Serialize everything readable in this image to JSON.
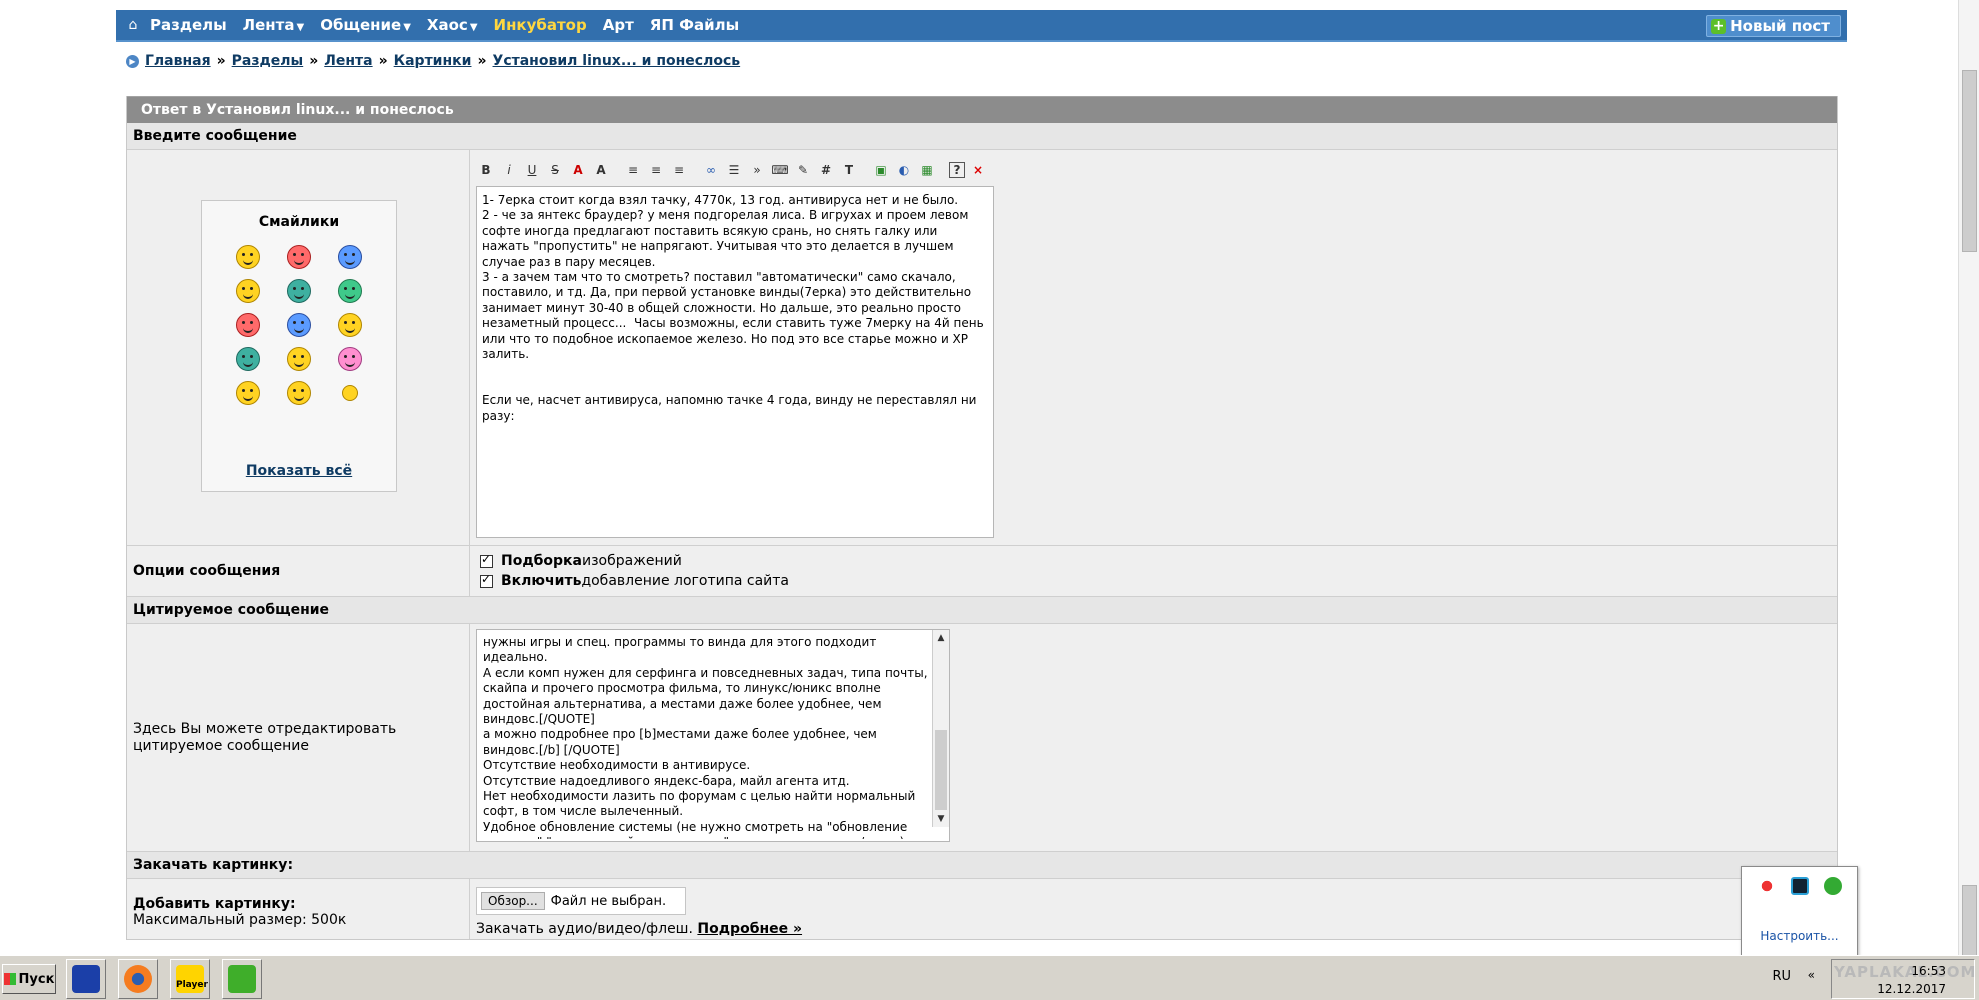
{
  "nav": {
    "items": [
      {
        "label": "Разделы",
        "caret": false,
        "highlight": false
      },
      {
        "label": "Лента",
        "caret": true,
        "highlight": false
      },
      {
        "label": "Общение",
        "caret": true,
        "highlight": false
      },
      {
        "label": "Хаос",
        "caret": true,
        "highlight": false
      },
      {
        "label": "Инкубатор",
        "caret": false,
        "highlight": true
      },
      {
        "label": "Арт",
        "caret": false,
        "highlight": false
      },
      {
        "label": "ЯП Файлы",
        "caret": false,
        "highlight": false
      }
    ],
    "new_post": "Новый пост",
    "home_icon": "home-icon",
    "highlight_color": "#ffd740",
    "bar_color": "#326fad"
  },
  "breadcrumb": [
    "Главная",
    "Разделы",
    "Лента",
    "Картинки",
    "Установил linux... и понеслось"
  ],
  "form": {
    "title": "Ответ в Установил linux... и понеслось",
    "enter_message": "Введите сообщение",
    "smilies_title": "Смайлики",
    "show_all": "Показать всё",
    "message_text": "1- 7ерка стоит когда взял тачку, 4770к, 13 год. антивируса нет и не было.\n2 - че за янтекс браудер? у меня подгорелая лиса. В игрухах и проем левом софте иногда предлагают поставить всякую срань, но снять галку или нажать \"пропустить\" не напрягают. Учитывая что это делается в лучшем случае раз в пару месяцев.\n3 - а зачем там что то смотреть? поставил \"автоматически\" само скачало, поставило, и тд. Да, при первой установке винды(7ерка) это действительно занимает минут 30-40 в общей сложности. Но дальше, это реально просто незаметный процесс...  Часы возможны, если ставить туже 7мерку на 4й пень или что то подобное ископаемое железо. Но под это все старье можно и ХР залить.\n\n\nЕсли че, насчет антивируса, напомню тачке 4 года, винду не переставлял ни разу:",
    "options_label": "Опции сообщения",
    "option1_bold": "Подборка",
    "option1_rest": " изображений",
    "option2_bold": "Включить",
    "option2_rest": " добавление логотипа сайта",
    "quoted_section": "Цитируемое сообщение",
    "quoted_label": "Здесь Вы можете отредактировать цитируемое сообщение",
    "quoted_text": "нужны игры и спец. программы то винда для этого подходит идеально.\nА если комп нужен для серфинга и повседневных задач, типа почты, скайпа и прочего просмотра фильма, то линукс/юникс вполне достойная альтернатива, а местами даже более удобнее, чем виндовс.[/QUOTE]\nа можно подробнее про [b]местами даже более удобнее, чем виндовс.[/b] [/QUOTE]\nОтсутствие необходимости в антивирусе.\nОтсутствие надоедливого яндекс-бара, майл агента итд.\nНет необходимости лазить по форумам с целью найти нормальный софт, в том числе вылеченный.\nУдобное обновление системы (не нужно смотреть на \"обновление системы\" \"не выключайте компьютер\" по несколько минут/часов)\nСписок можно продолжать достаточно долго...",
    "upload_section": "Закачать картинку:",
    "add_image": "Добавить картинку:",
    "max_size": "Максимальный размер: 500к",
    "browse": "Обзор...",
    "no_file": "Файл не выбран.",
    "media_text": "Закачать аудио/видео/флеш.",
    "more_link": "Подробнее »"
  },
  "toolbar_icons": [
    "B",
    "i",
    "U",
    "S",
    "A",
    "A",
    "≡",
    "≡",
    "≡",
    "∞",
    "☰",
    "»",
    "⌨",
    "✎",
    "#",
    "T",
    "▣",
    "◐",
    "▦",
    "?",
    "×"
  ],
  "tray": {
    "configure": "Настроить..."
  },
  "taskbar": {
    "start": "Пуск",
    "player": "Player",
    "lang": "RU",
    "time": "16:53",
    "date": "12.12.2017",
    "watermark": "YAPLAKAL.COM"
  }
}
